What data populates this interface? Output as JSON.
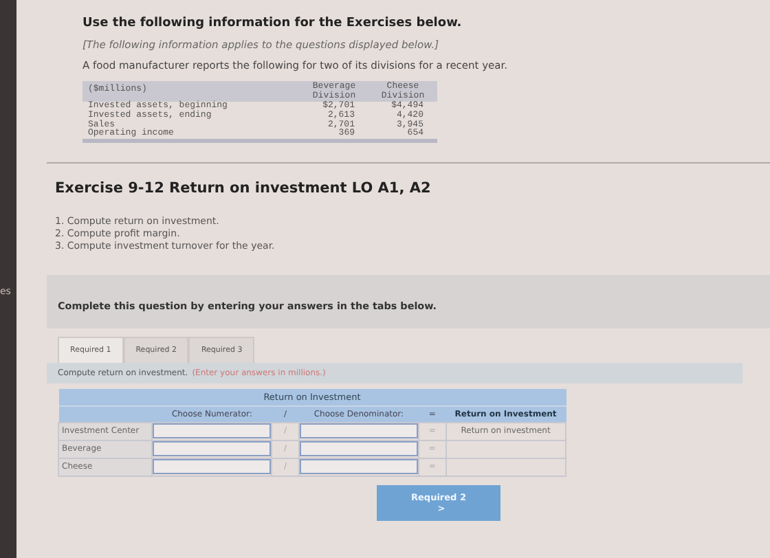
{
  "side_text": "es",
  "intro": {
    "heading": "Use the following information for the Exercises below.",
    "note": "[The following information applies to the questions displayed below.]",
    "text": "A food manufacturer reports the following for two of its divisions for a recent year."
  },
  "data_table": {
    "columns": [
      "($millions)",
      "Beverage Division",
      "Cheese Division"
    ],
    "rows": [
      [
        "Invested assets, beginning",
        "$2,701",
        "$4,494"
      ],
      [
        "Invested assets, ending",
        "2,613",
        "4,420"
      ],
      [
        "Sales",
        "2,701",
        "3,945"
      ],
      [
        "Operating income",
        "369",
        "654"
      ]
    ]
  },
  "exercise": {
    "title": "Exercise 9-12 Return on investment LO A1, A2",
    "tasks": [
      "1. Compute return on investment.",
      "2. Compute profit margin.",
      "3. Compute investment turnover for the year."
    ]
  },
  "instruction": "Complete this question by entering your answers in the tabs below.",
  "tabs": [
    {
      "label": "Required 1",
      "selected": true
    },
    {
      "label": "Required 2",
      "selected": false
    },
    {
      "label": "Required 3",
      "selected": false
    }
  ],
  "prompt": {
    "text": "Compute return on investment.",
    "hint": "(Enter your answers in millions.)"
  },
  "answer_table": {
    "title": "Return on Investment",
    "headers": [
      "Choose Numerator:",
      "/",
      "Choose Denominator:",
      "=",
      "Return on Investment"
    ],
    "rows": [
      {
        "label": "Investment Center",
        "divide": "/",
        "equals": "=",
        "result": "Return on investment"
      },
      {
        "label": "Beverage",
        "divide": "/",
        "equals": "="
      },
      {
        "label": "Cheese",
        "divide": "/",
        "equals": "="
      }
    ]
  },
  "next_button": {
    "label": "Required 2",
    "icon": ">"
  }
}
